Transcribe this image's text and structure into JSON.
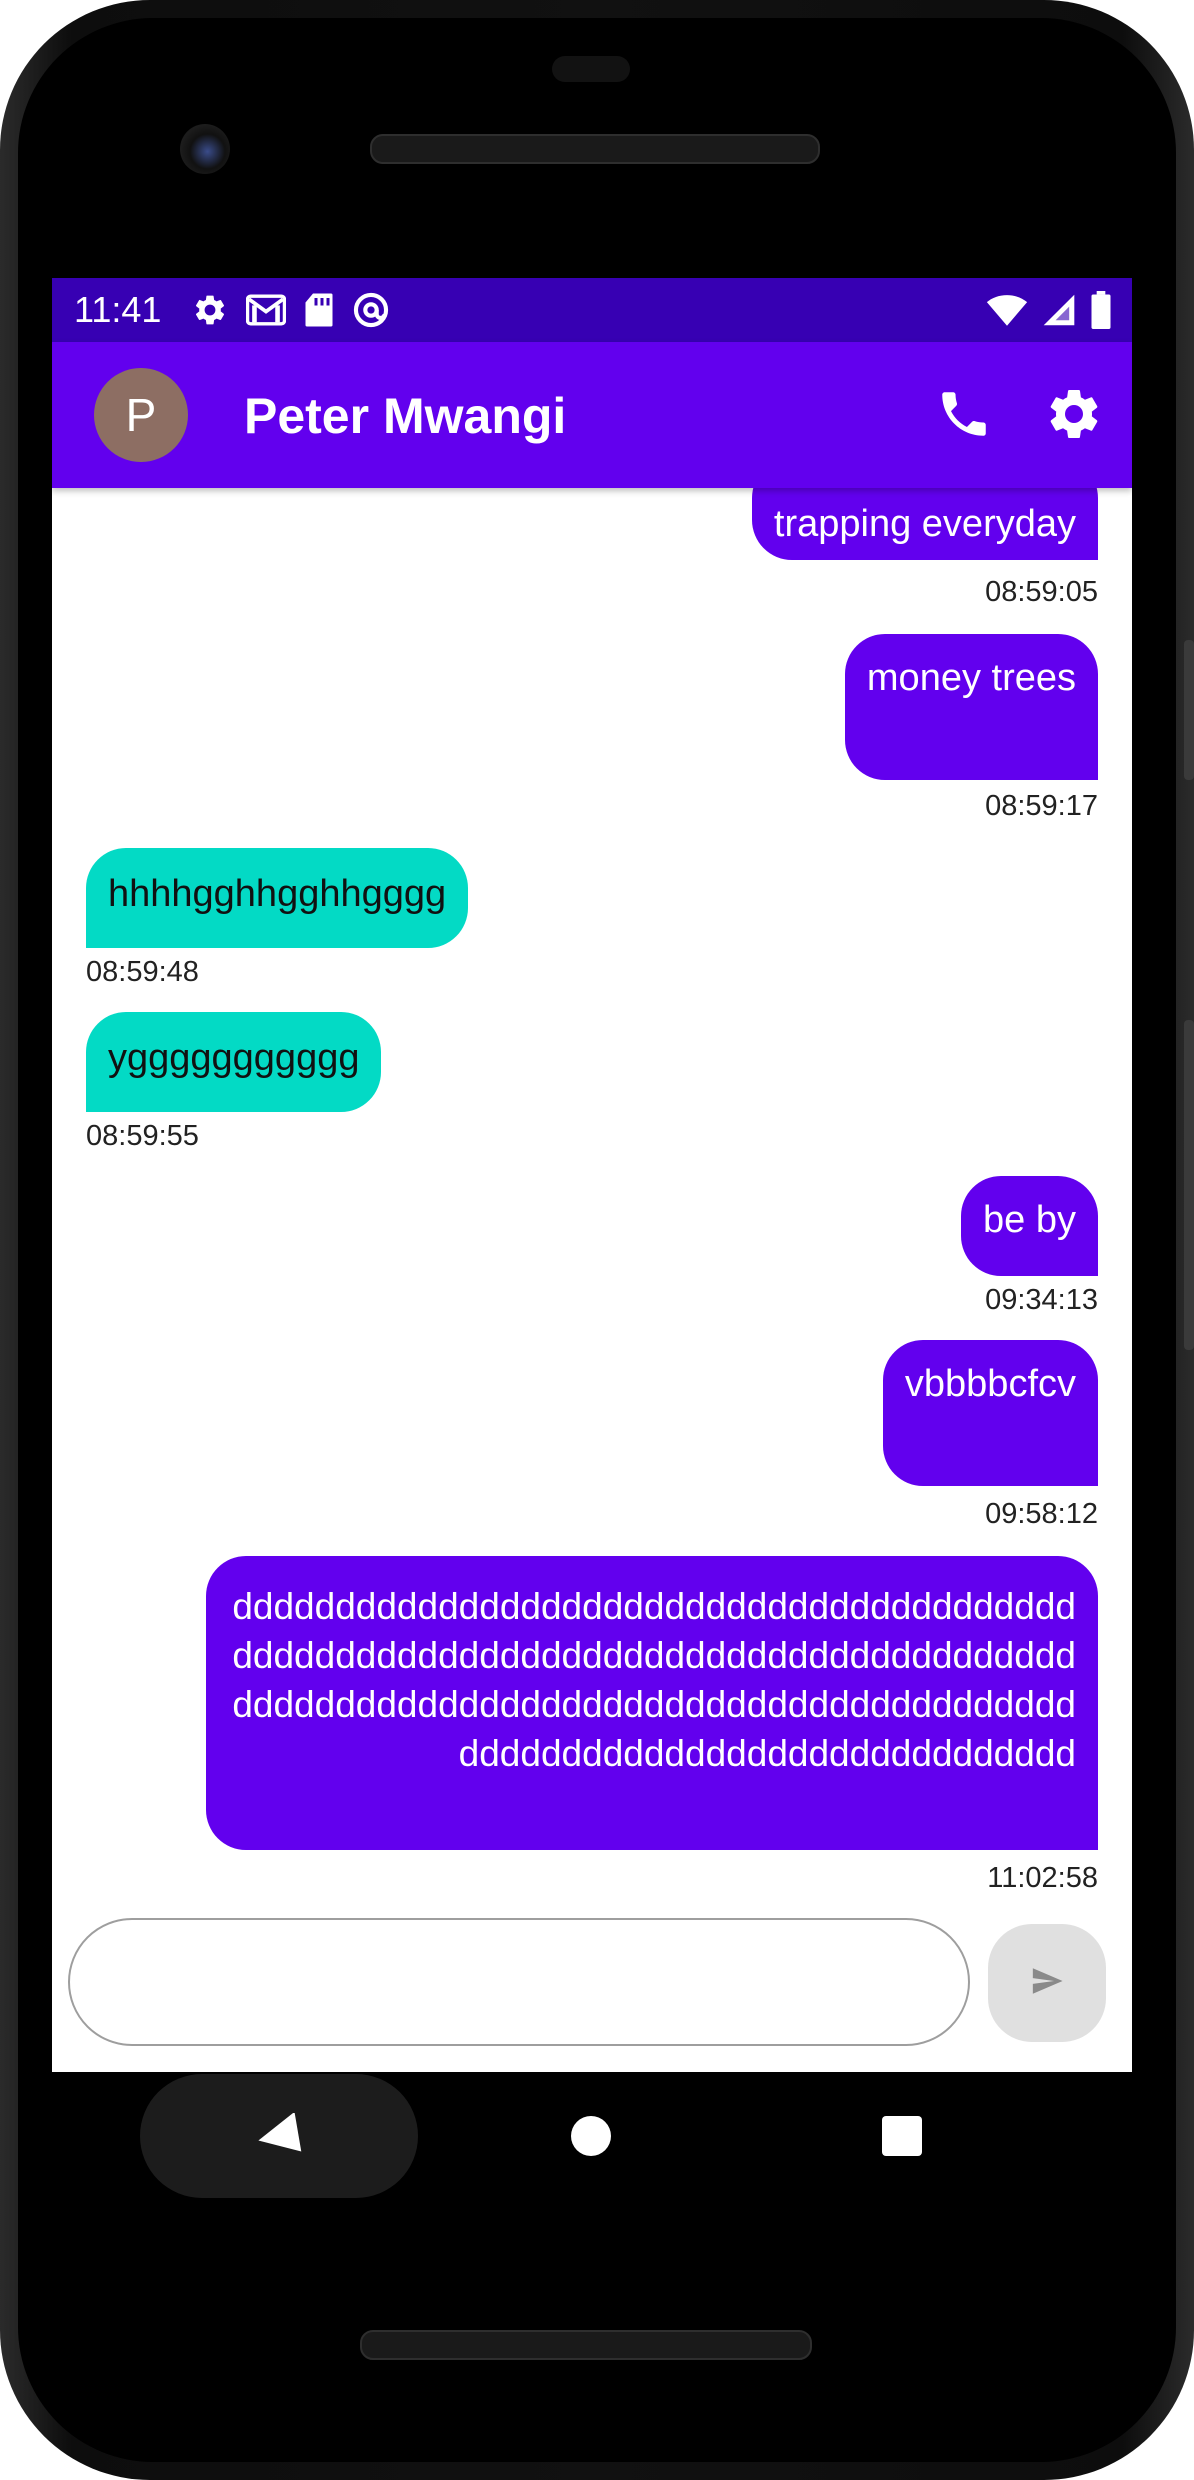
{
  "status_bar": {
    "time": "11:41",
    "left_icons": [
      "settings-icon",
      "gmail-icon",
      "sd-card-icon",
      "at-sign-icon"
    ],
    "right_icons": [
      "wifi-icon",
      "signal-icon",
      "battery-icon"
    ]
  },
  "app_bar": {
    "avatar_letter": "P",
    "contact_name": "Peter Mwangi",
    "actions": [
      "call-icon",
      "settings-icon"
    ]
  },
  "messages": [
    {
      "direction": "out",
      "text": "trapping everyday",
      "time": "08:59:05"
    },
    {
      "direction": "out",
      "text": "money trees",
      "time": "08:59:17"
    },
    {
      "direction": "in",
      "text": "hhhhgghhgghhgggg",
      "time": "08:59:48"
    },
    {
      "direction": "in",
      "text": "yggggggggggg",
      "time": "08:59:55"
    },
    {
      "direction": "out",
      "text": "be by",
      "time": "09:34:13"
    },
    {
      "direction": "out",
      "text": "vbbbbcfcv",
      "time": "09:58:12"
    },
    {
      "direction": "out",
      "text": "ddddddddddddddddddddddddddddddddddddddddddddddddddddddddddddddddddddddddddddddddddddddddddddddddddddddddddddddddddddddddddddddddddddddddddddddddddddddddd",
      "time": "11:02:58"
    }
  ],
  "composer": {
    "value": "",
    "placeholder": "",
    "send_icon": "send-icon"
  },
  "nav_bar": {
    "items": [
      "back-icon",
      "home-icon",
      "recents-icon"
    ]
  },
  "colors": {
    "status_bar": "#3700b3",
    "primary": "#6200ee",
    "incoming": "#03dac5",
    "avatar": "#8d6e63"
  }
}
